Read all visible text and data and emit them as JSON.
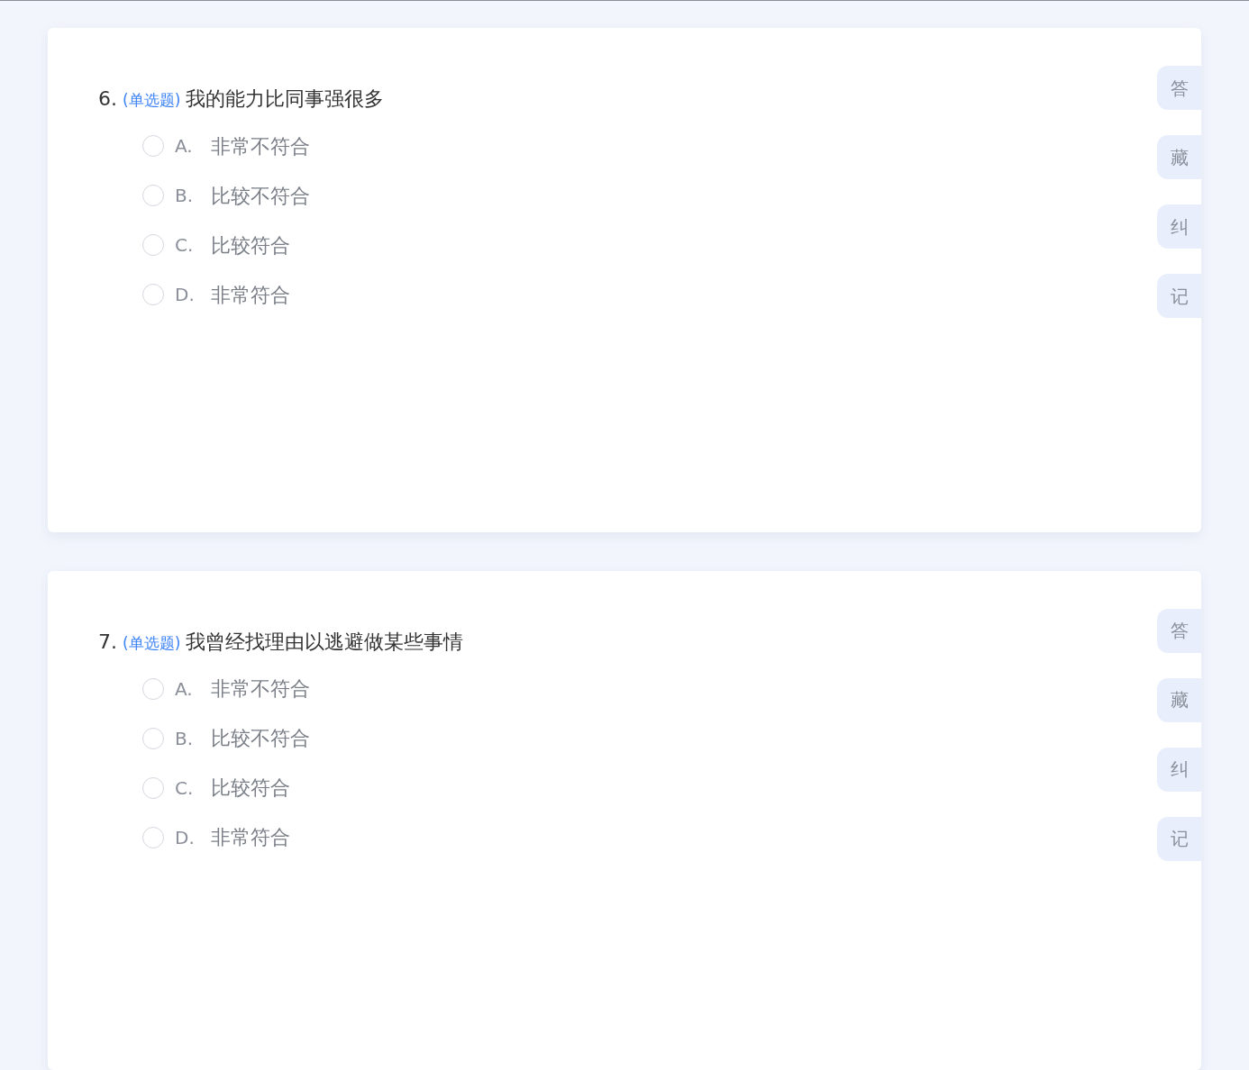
{
  "questions": [
    {
      "number": "6.",
      "type": "(单选题)",
      "text": "我的能力比同事强很多",
      "options": [
        {
          "letter": "A.",
          "text": "非常不符合",
          "selected": false
        },
        {
          "letter": "B.",
          "text": "比较不符合",
          "selected": false
        },
        {
          "letter": "C.",
          "text": "比较符合",
          "selected": false
        },
        {
          "letter": "D.",
          "text": "非常符合",
          "selected": false
        }
      ],
      "side_buttons": [
        "答",
        "藏",
        "纠",
        "记"
      ]
    },
    {
      "number": "7.",
      "type": "(单选题)",
      "text": "我曾经找理由以逃避做某些事情",
      "options": [
        {
          "letter": "A.",
          "text": "非常不符合",
          "selected": false
        },
        {
          "letter": "B.",
          "text": "比较不符合",
          "selected": false
        },
        {
          "letter": "C.",
          "text": "比较符合",
          "selected": false
        },
        {
          "letter": "D.",
          "text": "非常符合",
          "selected": false
        }
      ],
      "side_buttons": [
        "答",
        "藏",
        "纠",
        "记"
      ]
    }
  ]
}
